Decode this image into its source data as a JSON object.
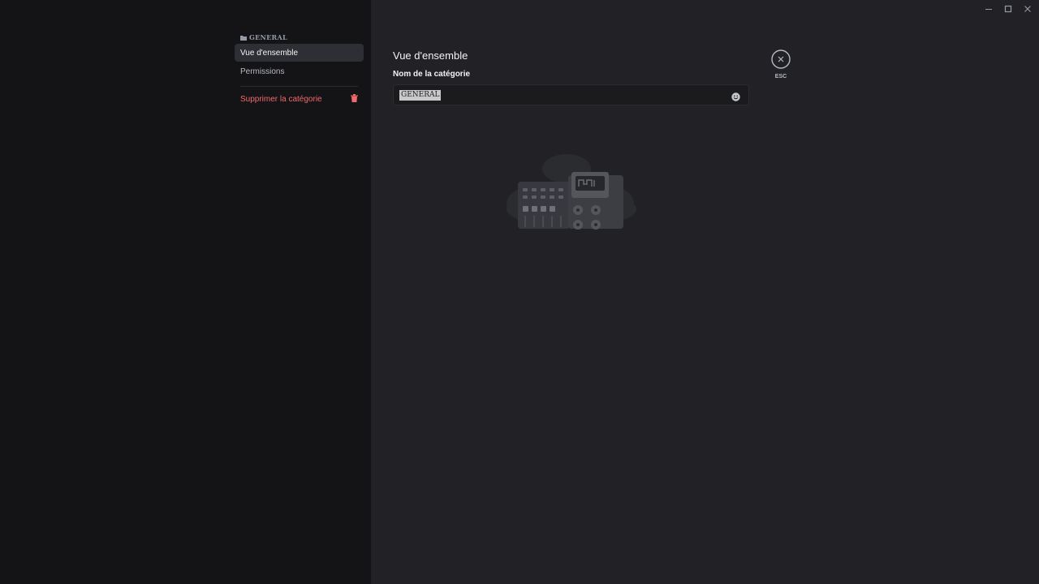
{
  "sidebar": {
    "category_header": "GENERAL",
    "items": [
      {
        "label": "Vue d'ensemble",
        "active": true
      },
      {
        "label": "Permissions",
        "active": false
      }
    ],
    "delete_label": "Supprimer la catégorie"
  },
  "main": {
    "title": "Vue d'ensemble",
    "field_label": "Nom de la catégorie",
    "field_value": "GENERAL"
  },
  "close": {
    "label": "ESC"
  },
  "icons": {
    "folder": "folder-icon",
    "trash": "trash-icon",
    "emoji": "emoji-icon",
    "close": "close-icon",
    "minimize": "minimize-icon",
    "maximize": "maximize-icon",
    "window_close": "window-close-icon"
  },
  "colors": {
    "sidebar_bg": "#141416",
    "main_bg": "#222226",
    "danger": "#f0696d",
    "active_item_bg": "#2e2f34"
  }
}
